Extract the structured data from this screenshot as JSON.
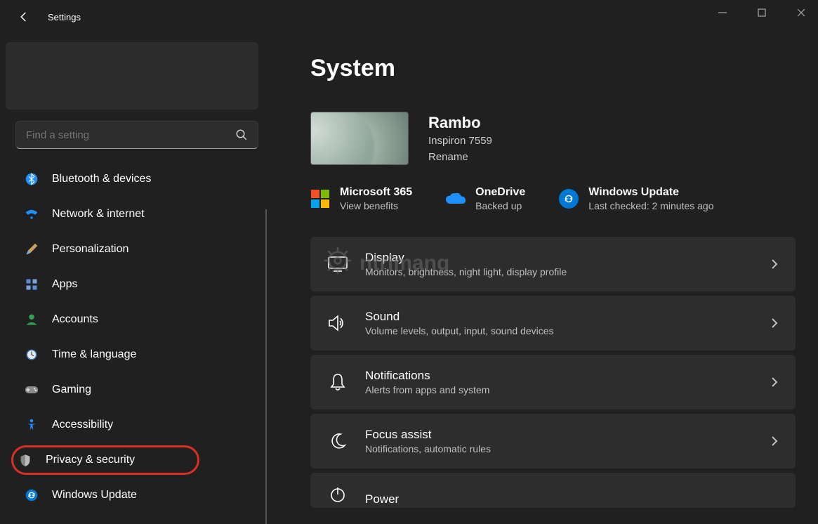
{
  "window": {
    "title": "Settings"
  },
  "search": {
    "placeholder": "Find a setting"
  },
  "sidebar": {
    "items": [
      {
        "id": "bluetooth",
        "label": "Bluetooth & devices",
        "icon": "bluetooth-icon"
      },
      {
        "id": "network",
        "label": "Network & internet",
        "icon": "wifi-icon"
      },
      {
        "id": "personalization",
        "label": "Personalization",
        "icon": "brush-icon"
      },
      {
        "id": "apps",
        "label": "Apps",
        "icon": "apps-icon"
      },
      {
        "id": "accounts",
        "label": "Accounts",
        "icon": "person-icon"
      },
      {
        "id": "time",
        "label": "Time & language",
        "icon": "clock-icon"
      },
      {
        "id": "gaming",
        "label": "Gaming",
        "icon": "gamepad-icon"
      },
      {
        "id": "accessibility",
        "label": "Accessibility",
        "icon": "accessibility-icon"
      },
      {
        "id": "privacy",
        "label": "Privacy & security",
        "icon": "shield-icon",
        "highlighted": true
      },
      {
        "id": "update",
        "label": "Windows Update",
        "icon": "sync-icon"
      }
    ]
  },
  "page": {
    "title": "System",
    "device": {
      "name": "Rambo",
      "model": "Inspiron 7559",
      "rename_label": "Rename"
    },
    "status": [
      {
        "title": "Microsoft 365",
        "sub": "View benefits",
        "icon": "microsoft-logo"
      },
      {
        "title": "OneDrive",
        "sub": "Backed up",
        "icon": "cloud-icon"
      },
      {
        "title": "Windows Update",
        "sub": "Last checked: 2 minutes ago",
        "icon": "sync-circle-icon"
      }
    ],
    "cards": [
      {
        "title": "Display",
        "sub": "Monitors, brightness, night light, display profile",
        "icon": "monitor-icon"
      },
      {
        "title": "Sound",
        "sub": "Volume levels, output, input, sound devices",
        "icon": "speaker-icon"
      },
      {
        "title": "Notifications",
        "sub": "Alerts from apps and system",
        "icon": "bell-icon"
      },
      {
        "title": "Focus assist",
        "sub": "Notifications, automatic rules",
        "icon": "moon-icon"
      },
      {
        "title": "Power",
        "sub": "",
        "icon": "power-icon"
      }
    ]
  },
  "colors": {
    "accent": "#0078d4",
    "highlight_ring": "#d93025",
    "background": "#202020",
    "card": "#2d2d2d",
    "text_secondary": "#bfbfbf"
  },
  "watermark": {
    "text": "ntrimang"
  }
}
